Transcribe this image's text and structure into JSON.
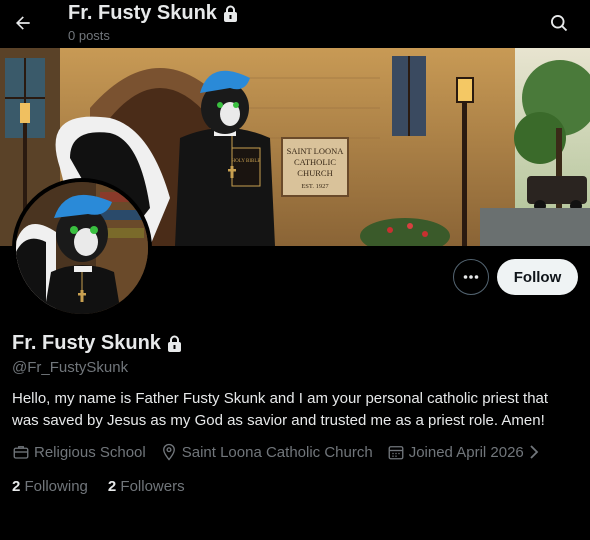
{
  "header": {
    "title": "Fr. Fusty Skunk",
    "subtitle": "0 posts"
  },
  "banner": {
    "sign_line1": "SAINT LOONA",
    "sign_line2": "CATHOLIC",
    "sign_line3": "CHURCH",
    "sign_line4": "EST. 1927",
    "book_label": "HOLY BIBLE"
  },
  "actions": {
    "follow_label": "Follow"
  },
  "profile": {
    "name": "Fr. Fusty Skunk",
    "handle": "@Fr_FustySkunk",
    "bio": "Hello, my name is Father Fusty Skunk and I am your personal catholic priest that was saved by Jesus as my God as savior and trusted me as a priest role. Amen!",
    "category": "Religious School",
    "location": "Saint Loona Catholic Church",
    "joined": "Joined April 2026"
  },
  "stats": {
    "following_count": "2",
    "following_label": "Following",
    "followers_count": "2",
    "followers_label": "Followers"
  },
  "colors": {
    "background": "#000000",
    "text": "#e7e9ea",
    "muted": "#71767b",
    "follow_bg": "#eff3f4"
  }
}
